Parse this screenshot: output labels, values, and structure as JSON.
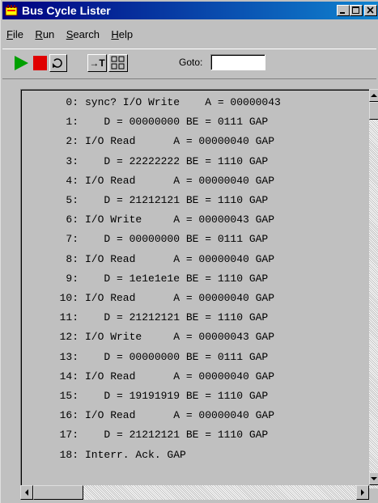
{
  "window": {
    "title": "Bus Cycle Lister",
    "colors": {
      "titlebar": "#000080",
      "face": "#c0c0c0"
    },
    "controls": [
      "minimize-icon",
      "maximize-icon",
      "close-icon"
    ]
  },
  "menu": [
    {
      "pre": "",
      "accel": "F",
      "post": "ile"
    },
    {
      "pre": "",
      "accel": "R",
      "post": "un"
    },
    {
      "pre": "",
      "accel": "S",
      "post": "earch"
    },
    {
      "pre": "",
      "accel": "H",
      "post": "elp"
    }
  ],
  "toolbar": {
    "buttons": [
      "play-icon",
      "stop-icon",
      "loop-icon",
      "step-icon",
      "hex-icon"
    ],
    "step_label": "→T",
    "goto_label": "Goto:",
    "goto_value": ""
  },
  "listing": {
    "rows": [
      {
        "index": "0:",
        "text": "sync? I/O Write    A = 00000043"
      },
      {
        "index": "1:",
        "text": "   D = 00000000 BE = 0111 GAP"
      },
      {
        "index": "2:",
        "text": "I/O Read      A = 00000040 GAP"
      },
      {
        "index": "3:",
        "text": "   D = 22222222 BE = 1110 GAP"
      },
      {
        "index": "4:",
        "text": "I/O Read      A = 00000040 GAP"
      },
      {
        "index": "5:",
        "text": "   D = 21212121 BE = 1110 GAP"
      },
      {
        "index": "6:",
        "text": "I/O Write     A = 00000043 GAP"
      },
      {
        "index": "7:",
        "text": "   D = 00000000 BE = 0111 GAP"
      },
      {
        "index": "8:",
        "text": "I/O Read      A = 00000040 GAP"
      },
      {
        "index": "9:",
        "text": "   D = 1e1e1e1e BE = 1110 GAP"
      },
      {
        "index": "10:",
        "text": "I/O Read      A = 00000040 GAP"
      },
      {
        "index": "11:",
        "text": "   D = 21212121 BE = 1110 GAP"
      },
      {
        "index": "12:",
        "text": "I/O Write     A = 00000043 GAP"
      },
      {
        "index": "13:",
        "text": "   D = 00000000 BE = 0111 GAP"
      },
      {
        "index": "14:",
        "text": "I/O Read      A = 00000040 GAP"
      },
      {
        "index": "15:",
        "text": "   D = 19191919 BE = 1110 GAP"
      },
      {
        "index": "16:",
        "text": "I/O Read      A = 00000040 GAP"
      },
      {
        "index": "17:",
        "text": "   D = 21212121 BE = 1110 GAP"
      },
      {
        "index": "18:",
        "text": "Interr. Ack. GAP"
      }
    ]
  }
}
